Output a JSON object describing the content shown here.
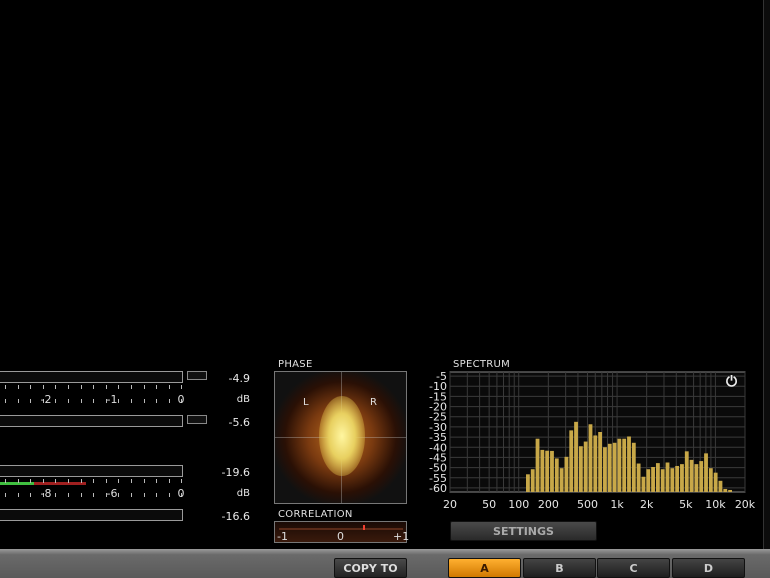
{
  "meters": {
    "top": {
      "left_value": "-4.9",
      "right_value": "-5.6",
      "unit": "dB",
      "scale_labels": [
        "-2",
        "-1",
        "0"
      ]
    },
    "bottom": {
      "left_value": "-19.6",
      "right_value": "-16.6",
      "unit": "dB",
      "scale_labels": [
        "-8",
        "-6",
        "0"
      ]
    }
  },
  "phase": {
    "title": "PHASE",
    "left": "L",
    "right": "R"
  },
  "correlation": {
    "title": "CORRELATION",
    "labels": [
      "-1",
      "0",
      "+1"
    ],
    "value": 0.1
  },
  "spectrum": {
    "title": "SPECTRUM",
    "power_icon": "power-icon",
    "settings_label": "SETTINGS"
  },
  "chart_data": {
    "type": "bar",
    "title": "SPECTRUM",
    "x_scale": "log",
    "xlim": [
      20,
      20000
    ],
    "ylim": [
      -62,
      -3
    ],
    "grid": true,
    "x_ticks": [
      "20",
      "50",
      "100",
      "200",
      "500",
      "1k",
      "2k",
      "5k",
      "10k",
      "20k"
    ],
    "y_ticks": [
      "-5",
      "-10",
      "-15",
      "-20",
      "-25",
      "-30",
      "-35",
      "-40",
      "-45",
      "-50",
      "-55",
      "-60"
    ],
    "bar_color": "#c8a848",
    "values": [
      -53.3,
      -50.8,
      -35.8,
      -41.3,
      -41.7,
      -41.8,
      -45.5,
      -50.3,
      -44.7,
      -31.7,
      -27.5,
      -39.5,
      -37.2,
      -28.7,
      -34.2,
      -32.5,
      -40,
      -38.3,
      -37.8,
      -35.8,
      -35.8,
      -34.7,
      -37.8,
      -48,
      -54.5,
      -50.8,
      -49.7,
      -47.8,
      -50.8,
      -47.5,
      -50.3,
      -49.2,
      -48.3,
      -42,
      -46.2,
      -48.3,
      -46.8,
      -43,
      -50.3,
      -52.5,
      -56.5,
      -60.5,
      -61
    ]
  },
  "footer": {
    "copy_to": "COPY TO",
    "slots": [
      "A",
      "B",
      "C",
      "D"
    ],
    "active_slot": "A",
    "accent": "#f0a020"
  }
}
